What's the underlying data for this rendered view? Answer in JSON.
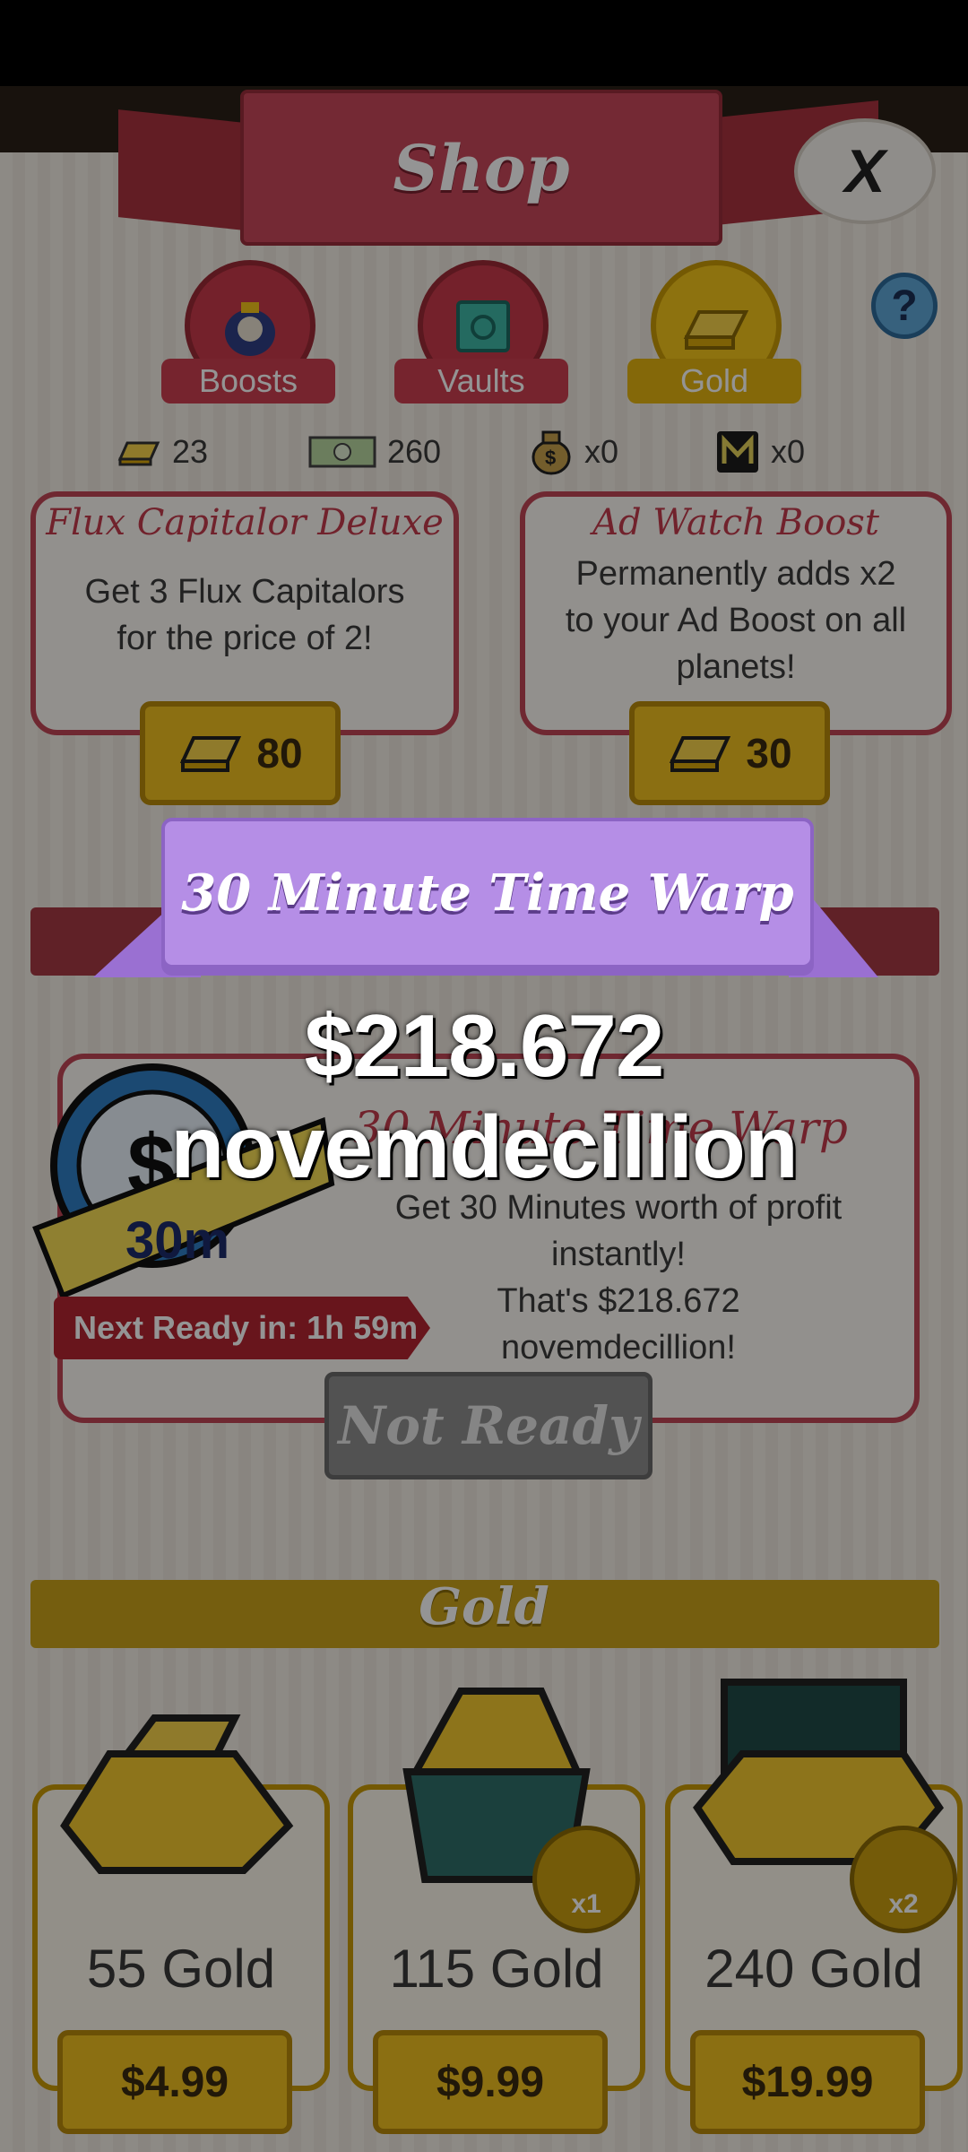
{
  "header": {
    "title": "Shop",
    "close_label": "X",
    "help_label": "?"
  },
  "tabs": [
    {
      "label": "Boosts",
      "icon": "money-bag-icon"
    },
    {
      "label": "Vaults",
      "icon": "vault-icon"
    },
    {
      "label": "Gold",
      "icon": "gold-bar-icon"
    }
  ],
  "currencies": [
    {
      "icon": "gold-bar-icon",
      "value": "23"
    },
    {
      "icon": "banknote-icon",
      "value": "260"
    },
    {
      "icon": "money-bag-icon",
      "value": "x0"
    },
    {
      "icon": "mega-icon",
      "value": "x0"
    }
  ],
  "boost_cards": [
    {
      "title": "Flux Capitalor Deluxe",
      "description_line1": "Get 3 Flux Capitalors",
      "description_line2": "for the price of 2!",
      "price": "80"
    },
    {
      "title": "Ad Watch Boost",
      "description_line1": "Permanently adds x2",
      "description_line2": "to your Ad Boost on all",
      "description_line3": "planets!",
      "price": "30"
    }
  ],
  "time_warp_popup": {
    "banner_title": "30 Minute Time Warp",
    "profit_amount": "$218.672 novemdecillion"
  },
  "time_warp_card": {
    "title": "30 Minute Time Warp",
    "timer_label": "30m",
    "description_line1": "Get 30 Minutes worth of profit",
    "description_line2": "instantly!",
    "description_line3": "That's $218.672 novemdecillion!",
    "next_ready": "Next Ready in: 1h 59m",
    "button_label": "Not Ready"
  },
  "gold_section": {
    "title": "Gold",
    "packs": [
      {
        "amount": "55 Gold",
        "price": "$4.99",
        "badge": ""
      },
      {
        "amount": "115 Gold",
        "price": "$9.99",
        "badge": "x1"
      },
      {
        "amount": "240 Gold",
        "price": "$19.99",
        "badge": "x2"
      }
    ]
  },
  "colors": {
    "accent_red": "#c9485a",
    "accent_gold": "#f0bf20",
    "banner_purple": "#b58ee6"
  }
}
